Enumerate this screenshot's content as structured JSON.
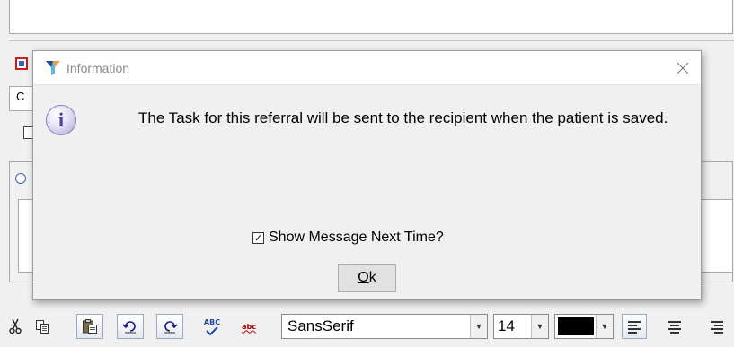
{
  "background": {
    "field_text": "C"
  },
  "dialog": {
    "title": "Information",
    "icon": "info-icon",
    "message": "The Task for this referral will be sent to the recipient when the patient is saved.",
    "show_message_checkbox": {
      "label": "Show Message Next Time?",
      "checked": true
    },
    "ok_button": {
      "mnemonic": "O",
      "rest": "k"
    }
  },
  "toolbar": {
    "icons": [
      "cut-icon",
      "copy-icon",
      "paste-icon",
      "undo-icon",
      "redo-icon",
      "spell-check-icon",
      "strikethrough-spell-icon",
      "align-left-icon",
      "align-center-icon",
      "align-right-icon"
    ],
    "spell_label": "ABC",
    "spell_alt_label": "abc",
    "font_family": "SansSerif",
    "font_size": "14",
    "font_color": "#000000"
  }
}
